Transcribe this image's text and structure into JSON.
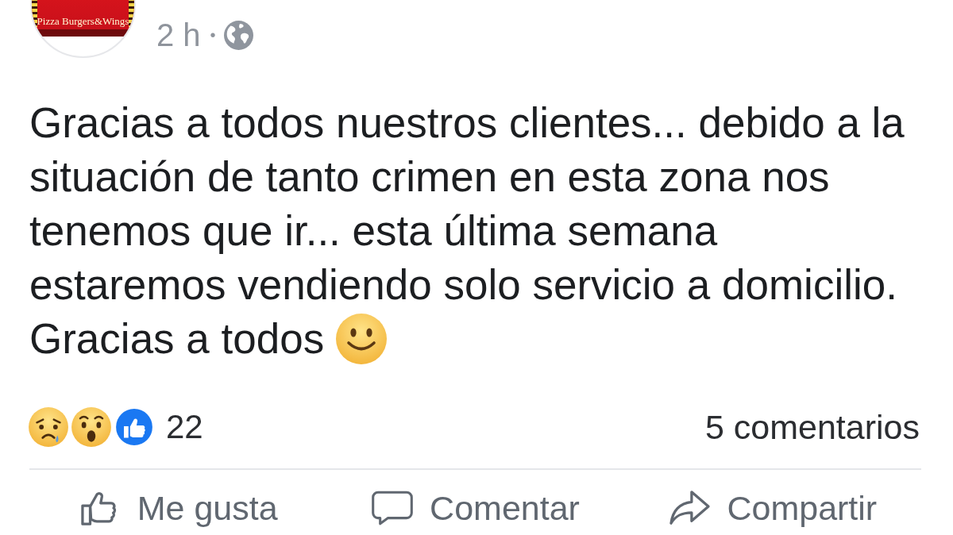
{
  "post": {
    "logo": {
      "tagline": "Pizza Burgers&Wings"
    },
    "time": "2 h",
    "separator": "•",
    "paragraphs": [
      {
        "kind": "plain",
        "text": "Gracias a todos nuestros clientes... debido a la situación de tanto crimen en esta zona nos tenemos que ir... esta última semana estaremos vendiendo solo servicio a domicilio."
      },
      {
        "kind": "smiley",
        "text": "Gracias a todos"
      }
    ]
  },
  "reactions": [
    {
      "kind": "sad"
    },
    {
      "kind": "wow"
    },
    {
      "kind": "like"
    }
  ],
  "reaction_count": "22",
  "comment_count": "5 comentarios",
  "actions": [
    {
      "kind": "like",
      "label": "Me gusta"
    },
    {
      "kind": "comment",
      "label": "Comentar"
    },
    {
      "kind": "share",
      "label": "Compartir"
    }
  ]
}
